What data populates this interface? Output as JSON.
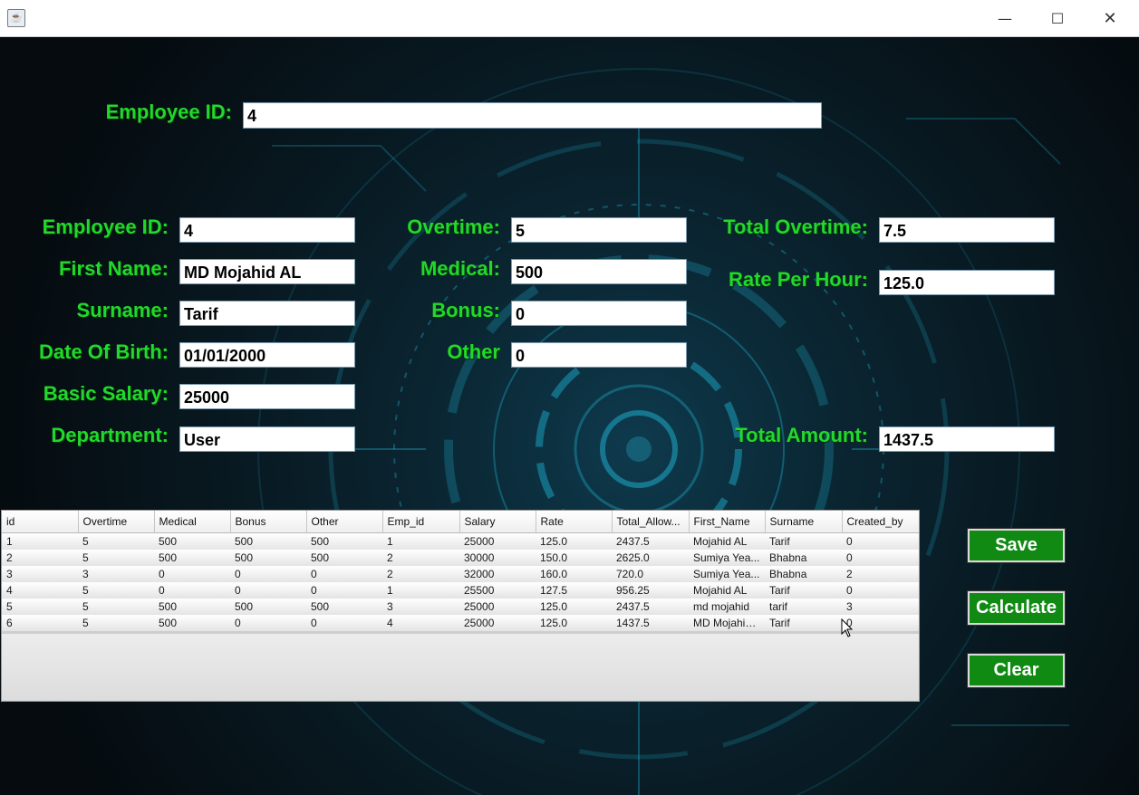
{
  "window": {
    "app_icon": "java-icon",
    "minimize_glyph": "—",
    "maximize_glyph": "☐",
    "close_glyph": "✕"
  },
  "search": {
    "label": "Employee ID:",
    "value": "4"
  },
  "form": {
    "employee_id": {
      "label": "Employee ID:",
      "value": "4"
    },
    "first_name": {
      "label": "First Name:",
      "value": "MD Mojahid AL"
    },
    "surname": {
      "label": "Surname:",
      "value": "Tarif"
    },
    "date_of_birth": {
      "label": "Date Of Birth:",
      "value": "01/01/2000"
    },
    "basic_salary": {
      "label": "Basic Salary:",
      "value": "25000"
    },
    "department": {
      "label": "Department:",
      "value": "User"
    },
    "overtime": {
      "label": "Overtime:",
      "value": "5"
    },
    "medical": {
      "label": "Medical:",
      "value": "500"
    },
    "bonus": {
      "label": "Bonus:",
      "value": "0"
    },
    "other": {
      "label": "Other",
      "value": "0"
    },
    "total_overtime": {
      "label": "Total Overtime:",
      "value": "7.5"
    },
    "rate_per_hour": {
      "label": "Rate Per Hour:",
      "value": "125.0"
    },
    "total_amount": {
      "label": "Total Amount:",
      "value": "1437.5"
    }
  },
  "table": {
    "columns": [
      "id",
      "Overtime",
      "Medical",
      "Bonus",
      "Other",
      "Emp_id",
      "Salary",
      "Rate",
      "Total_Allow...",
      "First_Name",
      "Surname",
      "Created_by"
    ],
    "rows": [
      [
        "1",
        "5",
        "500",
        "500",
        "500",
        "1",
        "25000",
        "125.0",
        "2437.5",
        "Mojahid AL",
        "Tarif",
        "0"
      ],
      [
        "2",
        "5",
        "500",
        "500",
        "500",
        "2",
        "30000",
        "150.0",
        "2625.0",
        "Sumiya Yea...",
        "Bhabna",
        "0"
      ],
      [
        "3",
        "3",
        "0",
        "0",
        "0",
        "2",
        "32000",
        "160.0",
        "720.0",
        "Sumiya Yea...",
        "Bhabna",
        "2"
      ],
      [
        "4",
        "5",
        "0",
        "0",
        "0",
        "1",
        "25500",
        "127.5",
        "956.25",
        "Mojahid AL",
        "Tarif",
        "0"
      ],
      [
        "5",
        "5",
        "500",
        "500",
        "500",
        "3",
        "25000",
        "125.0",
        "2437.5",
        "md mojahid",
        "tarif",
        "3"
      ],
      [
        "6",
        "5",
        "500",
        "0",
        "0",
        "4",
        "25000",
        "125.0",
        "1437.5",
        "MD Mojahid...",
        "Tarif",
        "0"
      ]
    ]
  },
  "buttons": {
    "save": "Save",
    "calculate": "Calculate",
    "clear": "Clear"
  },
  "colors": {
    "label_green": "#22d82a",
    "button_green": "#118a14"
  }
}
